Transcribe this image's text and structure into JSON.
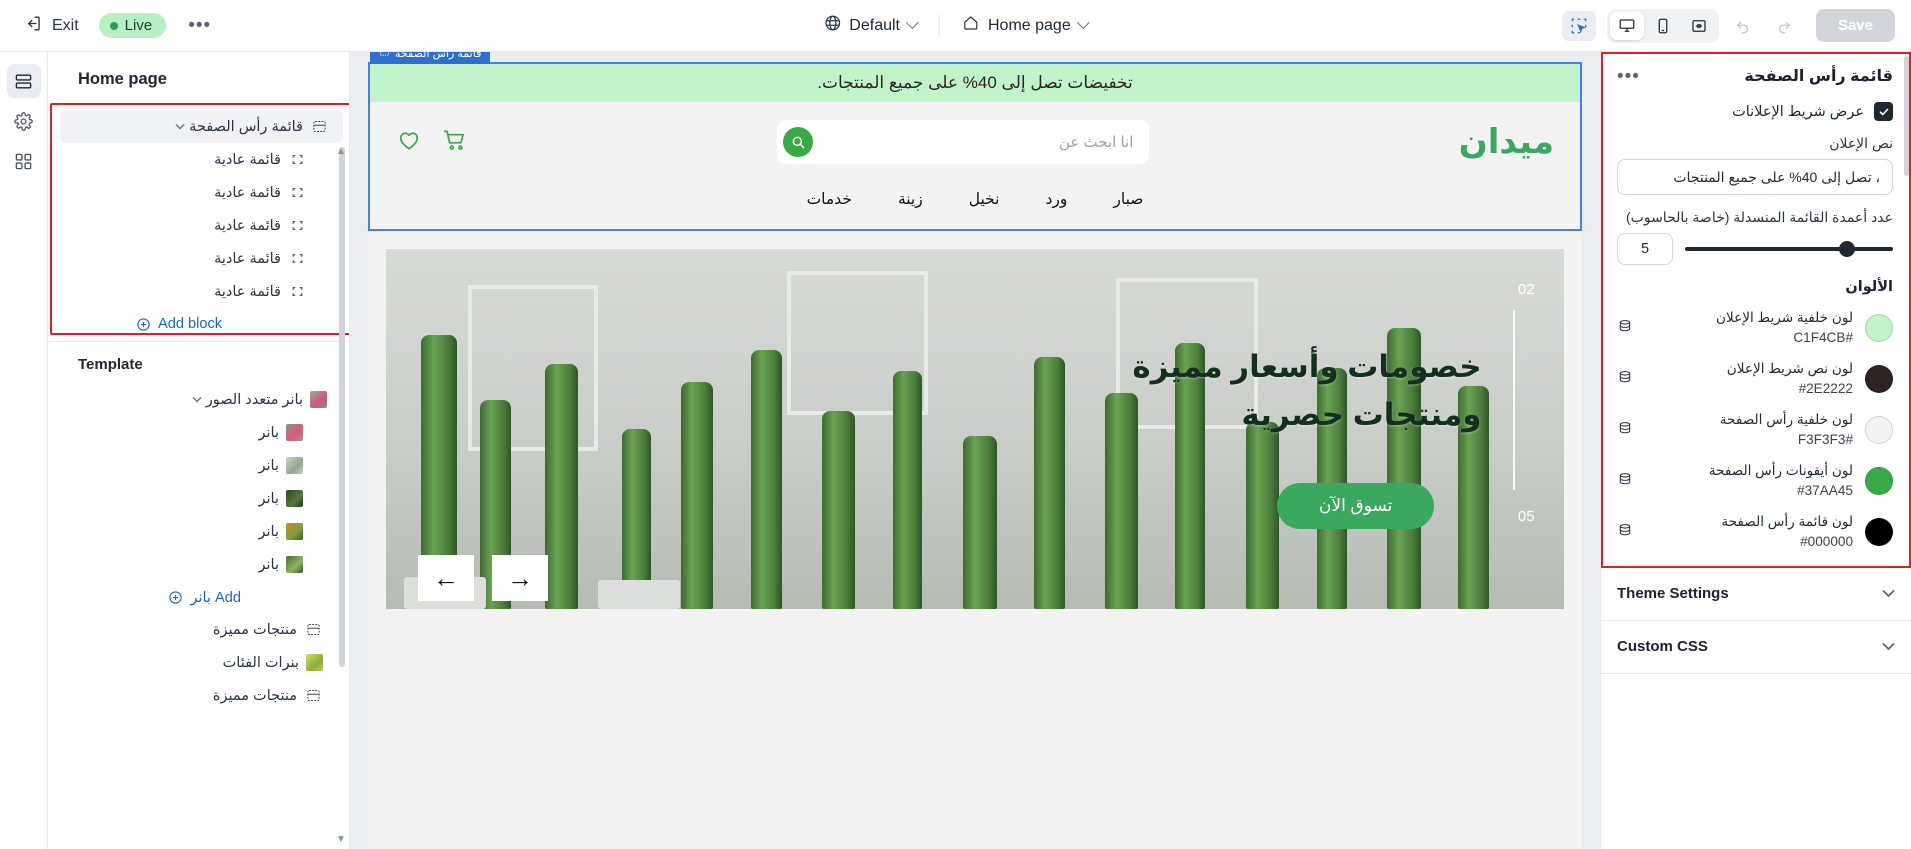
{
  "topbar": {
    "exit_label": "Exit",
    "live_label": "Live",
    "more_label": "•••",
    "theme_select": "Default",
    "page_select": "Home page",
    "save_label": "Save",
    "icons": {
      "exit": "exit-icon",
      "globe": "globe-icon",
      "home": "home-icon",
      "select_tool": "select-tool-icon",
      "desktop": "desktop-icon",
      "mobile": "mobile-icon",
      "fullwidth": "fullwidth-icon",
      "undo": "undo-icon",
      "redo": "redo-icon"
    }
  },
  "rail": {
    "items": [
      {
        "name": "layers",
        "active": true
      },
      {
        "name": "settings",
        "active": false
      },
      {
        "name": "apps",
        "active": false
      }
    ]
  },
  "leftpanel": {
    "title": "Home page",
    "header_section": {
      "label": "قائمة رأس الصفحة",
      "children": [
        "قائمة عادية",
        "قائمة عادية",
        "قائمة عادية",
        "قائمة عادية",
        "قائمة عادية"
      ],
      "add_label": "Add block"
    },
    "template_title": "Template",
    "template_items": [
      {
        "label": "بانر متعدد الصور",
        "type": "group",
        "expanded": true
      },
      {
        "label": "بانر",
        "type": "child",
        "thumb": "#d4547e"
      },
      {
        "label": "بانر",
        "type": "child",
        "thumb": "#9fb89a"
      },
      {
        "label": "بانر",
        "type": "child",
        "thumb": "#3c5a2c"
      },
      {
        "label": "بانر",
        "type": "child",
        "thumb": "#b06a2a"
      },
      {
        "label": "بانر",
        "type": "child",
        "thumb": "#6d8f4a"
      }
    ],
    "template_add_label": "Add بانر",
    "template_tail": [
      {
        "label": "منتجات مميزة",
        "icon": "section-icon"
      },
      {
        "label": "بنرات الفئات",
        "icon": "image-icon",
        "thumb": "#c3cf5a"
      },
      {
        "label": "منتجات مميزة",
        "icon": "section-icon"
      }
    ]
  },
  "canvas": {
    "block_tag": "قائمة رأس الصفحة",
    "announcement": "تخفيضات تصل إلى 40% على جميع المنتجات.",
    "logo": "ميدان",
    "search_placeholder": "انا ابحث عن",
    "nav_items": [
      "صبار",
      "ورد",
      "نخيل",
      "زينة",
      "خدمات"
    ],
    "hero": {
      "line1": "خصومات وأسعار مميزة",
      "line2": "ومنتجات حصرية",
      "cta": "تسوق الآن",
      "counter_current": "02",
      "counter_total": "05",
      "prev_arrow": "←",
      "next_arrow": "→"
    }
  },
  "rightpanel": {
    "title": "قائمة رأس الصفحة",
    "more_label": "•••",
    "show_announcement_label": "عرض شريط الإعلانات",
    "show_announcement_checked": true,
    "announcement_text_label": "نص الإعلان",
    "announcement_text_value": "، تصل إلى 40% على جميع المنتجات",
    "columns_label": "عدد أعمدة القائمة المنسدلة (خاصة بالحاسوب)",
    "columns_value": "5",
    "columns_percent": 78,
    "colors_title": "الألوان",
    "colors": [
      {
        "name": "لون خلفية شريط الإعلان",
        "hex": "#C1F4CB"
      },
      {
        "name": "لون نص شريط الإعلان",
        "hex": "#2E2222"
      },
      {
        "name": "لون خلفية رأس الصفحة",
        "hex": "#F3F3F3"
      },
      {
        "name": "لون أيقونات رأس الصفحة",
        "hex": "#37AA45"
      },
      {
        "name": "لون قائمة رأس الصفحة",
        "hex": "#000000"
      }
    ],
    "accordions": [
      {
        "label": "Theme Settings"
      },
      {
        "label": "Custom CSS"
      }
    ]
  },
  "theme": {
    "accent_blue": "#2f6fd0",
    "link_blue": "#1a66d0",
    "highlight_red": "#E02020",
    "green": "#37AA45",
    "announce_bg": "#C1F4CB"
  }
}
